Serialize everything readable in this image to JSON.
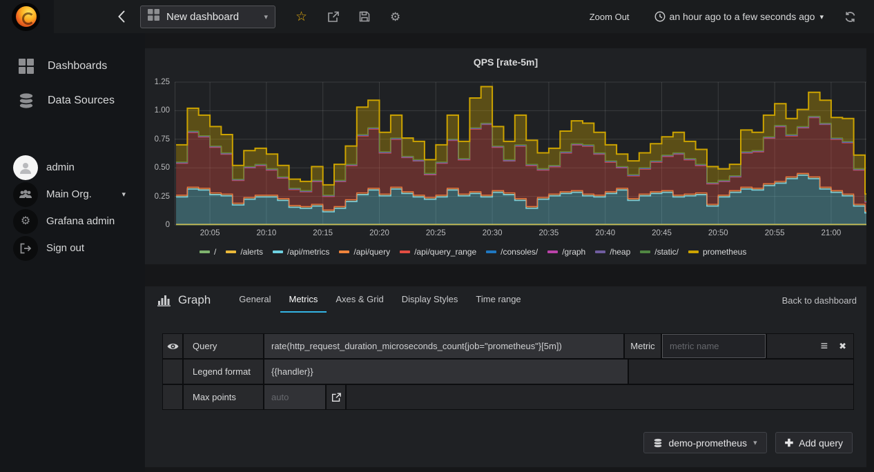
{
  "header": {
    "dashboard_title": "New dashboard",
    "zoom_out_label": "Zoom Out",
    "time_range_label": "an hour ago to a few seconds ago"
  },
  "sidebar": {
    "items": [
      {
        "label": "Dashboards"
      },
      {
        "label": "Data Sources"
      }
    ],
    "user_items": [
      {
        "label": "admin"
      },
      {
        "label": "Main Org."
      },
      {
        "label": "Grafana admin"
      },
      {
        "label": "Sign out"
      }
    ]
  },
  "graph_panel": {
    "title": "QPS [rate-5m]"
  },
  "editor": {
    "panel_type_label": "Graph",
    "tabs": [
      "General",
      "Metrics",
      "Axes & Grid",
      "Display Styles",
      "Time range"
    ],
    "active_tab": "Metrics",
    "back_link": "Back to dashboard",
    "query_label": "Query",
    "query_value": "rate(http_request_duration_microseconds_count{job=\"prometheus\"}[5m])",
    "metric_label": "Metric",
    "metric_placeholder": "metric name",
    "legend_format_label": "Legend format",
    "legend_format_value": "{{handler}}",
    "max_points_label": "Max points",
    "max_points_placeholder": "auto",
    "datasource_button": "demo-prometheus",
    "add_query_button": "Add query"
  },
  "chart_data": {
    "type": "area",
    "stacked": true,
    "title": "QPS [rate-5m]",
    "ylim": [
      0,
      1.25
    ],
    "yticks": [
      {
        "v": 0,
        "label": "0"
      },
      {
        "v": 0.25,
        "label": "0.25"
      },
      {
        "v": 0.5,
        "label": "0.50"
      },
      {
        "v": 0.75,
        "label": "0.75"
      },
      {
        "v": 1.0,
        "label": "1.00"
      },
      {
        "v": 1.25,
        "label": "1.25"
      }
    ],
    "x_start": "20:02",
    "x_step_minutes": 1,
    "xticks": [
      {
        "m": 3,
        "label": "20:05"
      },
      {
        "m": 8,
        "label": "20:10"
      },
      {
        "m": 13,
        "label": "20:15"
      },
      {
        "m": 18,
        "label": "20:20"
      },
      {
        "m": 23,
        "label": "20:25"
      },
      {
        "m": 28,
        "label": "20:30"
      },
      {
        "m": 33,
        "label": "20:35"
      },
      {
        "m": 38,
        "label": "20:40"
      },
      {
        "m": 43,
        "label": "20:45"
      },
      {
        "m": 48,
        "label": "20:50"
      },
      {
        "m": 53,
        "label": "20:55"
      },
      {
        "m": 58,
        "label": "21:00"
      }
    ],
    "legend_position": "bottom",
    "grid": true,
    "series": [
      {
        "name": "/",
        "color": "#7EB26D",
        "constant": 0.002
      },
      {
        "name": "/alerts",
        "color": "#EAB839",
        "constant": 0.004
      },
      {
        "name": "/api/metrics",
        "color": "#6ED0E0",
        "values": [
          0.24,
          0.31,
          0.3,
          0.26,
          0.25,
          0.17,
          0.22,
          0.24,
          0.24,
          0.21,
          0.15,
          0.14,
          0.16,
          0.11,
          0.14,
          0.2,
          0.26,
          0.3,
          0.25,
          0.31,
          0.27,
          0.24,
          0.22,
          0.24,
          0.3,
          0.25,
          0.27,
          0.24,
          0.28,
          0.26,
          0.21,
          0.14,
          0.22,
          0.25,
          0.27,
          0.28,
          0.25,
          0.24,
          0.27,
          0.3,
          0.21,
          0.25,
          0.27,
          0.28,
          0.24,
          0.25,
          0.26,
          0.16,
          0.24,
          0.28,
          0.31,
          0.3,
          0.34,
          0.36,
          0.4,
          0.43,
          0.4,
          0.31,
          0.28,
          0.25,
          0.16,
          0.1
        ]
      },
      {
        "name": "/api/query",
        "color": "#EF843C",
        "constant": 0.015
      },
      {
        "name": "/api/query_range",
        "color": "#E24D42",
        "values": [
          0.28,
          0.48,
          0.45,
          0.4,
          0.35,
          0.2,
          0.26,
          0.26,
          0.22,
          0.18,
          0.14,
          0.13,
          0.2,
          0.12,
          0.22,
          0.3,
          0.5,
          0.52,
          0.36,
          0.42,
          0.3,
          0.3,
          0.2,
          0.28,
          0.42,
          0.3,
          0.55,
          0.62,
          0.38,
          0.28,
          0.46,
          0.36,
          0.24,
          0.24,
          0.34,
          0.4,
          0.42,
          0.36,
          0.26,
          0.18,
          0.2,
          0.22,
          0.26,
          0.3,
          0.36,
          0.3,
          0.24,
          0.18,
          0.12,
          0.12,
          0.3,
          0.32,
          0.4,
          0.48,
          0.36,
          0.4,
          0.52,
          0.55,
          0.45,
          0.45,
          0.3,
          0.08
        ]
      },
      {
        "name": "/consoles/",
        "color": "#1F78C1",
        "constant": 0.002
      },
      {
        "name": "/graph",
        "color": "#BA43A9",
        "constant": 0.002
      },
      {
        "name": "/heap",
        "color": "#705DA0",
        "constant": 0.002
      },
      {
        "name": "/static/",
        "color": "#508642",
        "constant": 0.004
      },
      {
        "name": "prometheus",
        "color": "#CCA300",
        "values": [
          0.15,
          0.2,
          0.18,
          0.17,
          0.16,
          0.12,
          0.14,
          0.14,
          0.13,
          0.1,
          0.08,
          0.08,
          0.12,
          0.09,
          0.14,
          0.16,
          0.24,
          0.24,
          0.17,
          0.2,
          0.16,
          0.16,
          0.12,
          0.15,
          0.21,
          0.15,
          0.26,
          0.32,
          0.17,
          0.16,
          0.26,
          0.21,
          0.14,
          0.15,
          0.18,
          0.2,
          0.19,
          0.18,
          0.14,
          0.11,
          0.12,
          0.13,
          0.15,
          0.16,
          0.18,
          0.15,
          0.13,
          0.14,
          0.1,
          0.1,
          0.19,
          0.16,
          0.19,
          0.19,
          0.14,
          0.15,
          0.21,
          0.2,
          0.18,
          0.2,
          0.12,
          0.06
        ]
      }
    ]
  }
}
